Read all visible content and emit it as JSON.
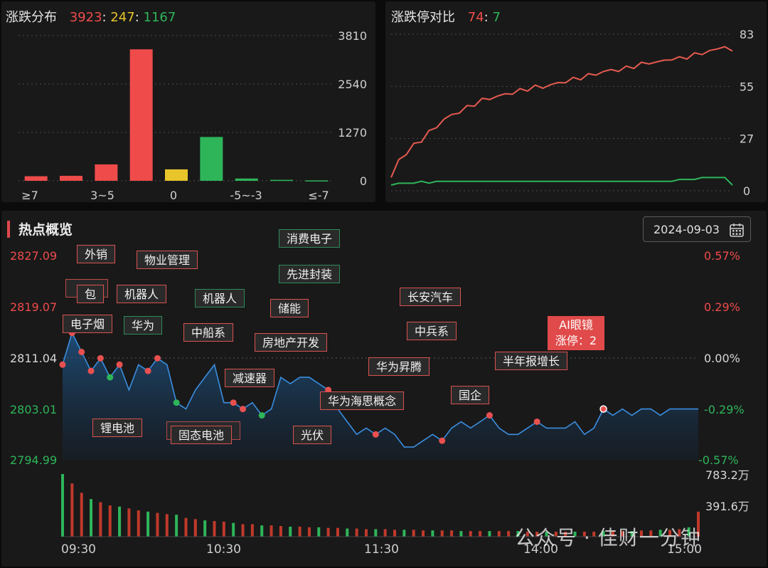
{
  "distribution": {
    "title": "涨跌分布",
    "up": "3923",
    "flat": "247",
    "down": "1167",
    "sep": ":",
    "y_ticks": [
      "3810",
      "2540",
      "1270",
      "0"
    ],
    "x_labels": [
      "≥7",
      "3~5",
      "0",
      "-5~-3",
      "≤-7"
    ]
  },
  "limit_ratio": {
    "title": "涨跌停对比",
    "limit_up": "74",
    "limit_down": "7",
    "sep": ":",
    "y_ticks": [
      "83",
      "55",
      "27",
      "0"
    ]
  },
  "hot": {
    "title": "热点概览",
    "date": "2024-09-03",
    "price_ticks": [
      "2827.09",
      "2819.07",
      "2811.04",
      "2803.01",
      "2794.99"
    ],
    "pct_ticks": [
      "0.57%",
      "0.29%",
      "0.00%",
      "-0.29%",
      "-0.57%"
    ],
    "vol_ticks": [
      "783.2万",
      "391.6万"
    ],
    "time_labels": [
      "09:30",
      "10:30",
      "11:30",
      "14:00",
      "15:00"
    ],
    "tags": {
      "t1": "外销",
      "t2": "物业管理",
      "t3": "包",
      "t4": "机器人",
      "t5": "电子烟",
      "t6": "华为",
      "t7": "机器人",
      "t8": "中船系",
      "t9": "消费电子",
      "t10": "先进封装",
      "t11": "储能",
      "t12": "房地产开发",
      "t13": "减速器",
      "t14": "锂电池",
      "t15": "固态电池",
      "t16": "华为海思概念",
      "t17": "光伏",
      "t18": "华为昇腾",
      "t19": "长安汽车",
      "t20": "中兵系",
      "t21": "国企",
      "t22": "半年报增长"
    },
    "ai_tag": {
      "name": "AI眼镜",
      "stat": "涨停：2"
    },
    "watermark": "公众号 · 佳财一分钟"
  },
  "chart_data": [
    {
      "type": "bar",
      "title": "涨跌分布",
      "categories": [
        "≥7",
        "",
        "3~5",
        "",
        "0",
        "",
        "-5~-3",
        "",
        "≤-7"
      ],
      "values": [
        120,
        130,
        430,
        3450,
        300,
        1150,
        60,
        25,
        10
      ],
      "colors": [
        "#ef4b4b",
        "#ef4b4b",
        "#ef4b4b",
        "#ef4b4b",
        "#e8c52a",
        "#2eb55a",
        "#2eb55a",
        "#2eb55a",
        "#2eb55a"
      ],
      "ylim": [
        0,
        3810
      ]
    },
    {
      "type": "line",
      "title": "涨跌停对比",
      "ylim": [
        0,
        83
      ],
      "series": [
        {
          "name": "",
          "color": "#e65a4f",
          "values": [
            7,
            16,
            20,
            24,
            27,
            31,
            34,
            38,
            40,
            42,
            44,
            46,
            48,
            49,
            50,
            51,
            52,
            53,
            54,
            55,
            55,
            56,
            57,
            58,
            59,
            60,
            61,
            62,
            63,
            64,
            64,
            65,
            66,
            67,
            68,
            68,
            69,
            70,
            70,
            71,
            72,
            73,
            74,
            75,
            77,
            73
          ]
        },
        {
          "name": "",
          "color": "#2eb55a",
          "values": [
            3,
            4,
            4,
            4,
            5,
            4,
            5,
            5,
            5,
            5,
            5,
            5,
            5,
            5,
            5,
            5,
            5,
            5,
            5,
            5,
            5,
            5,
            5,
            5,
            5,
            5,
            5,
            5,
            5,
            5,
            5,
            5,
            5,
            5,
            5,
            5,
            5,
            5,
            6,
            6,
            6,
            7,
            7,
            7,
            7,
            3
          ]
        }
      ]
    },
    {
      "type": "area",
      "title": "热点概览",
      "ylim": [
        2794.99,
        2827.09
      ],
      "price": [
        2810,
        2815,
        2812,
        2809,
        2811,
        2808,
        2810,
        2806,
        2810,
        2809,
        2811,
        2810,
        2804,
        2803,
        2806,
        2808,
        2810,
        2804,
        2804,
        2803,
        2804,
        2802,
        2803,
        2808,
        2807,
        2808,
        2808,
        2807,
        2806,
        2803,
        2801,
        2799,
        2800,
        2799,
        2800,
        2799,
        2797,
        2797,
        2798,
        2799,
        2798,
        2800,
        2801,
        2800,
        2801,
        2802,
        2800,
        2799,
        2799,
        2800,
        2801,
        2800,
        2800,
        2800,
        2801,
        2799,
        2800,
        2803,
        2802,
        2803,
        2802,
        2803,
        2803,
        2802,
        2803,
        2803,
        2803,
        2803
      ],
      "volume": [
        100,
        85,
        70,
        60,
        55,
        50,
        48,
        45,
        42,
        40,
        38,
        36,
        35,
        30,
        28,
        26,
        25,
        24,
        22,
        20,
        20,
        18,
        18,
        17,
        16,
        16,
        15,
        15,
        14,
        14,
        13,
        13,
        12,
        12,
        12,
        11,
        11,
        11,
        10,
        10,
        10,
        10,
        9,
        9,
        9,
        9,
        9,
        9,
        9,
        8,
        8,
        8,
        8,
        8,
        8,
        8,
        8,
        9,
        9,
        9,
        9,
        10,
        10,
        11,
        11,
        12,
        15,
        40
      ]
    }
  ]
}
